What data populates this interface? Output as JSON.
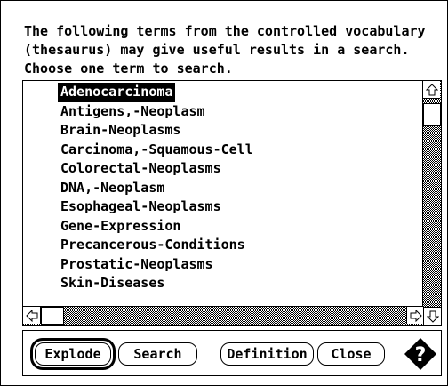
{
  "dialog": {
    "prompt": "The following terms from the controlled vocabulary\n(thesaurus) may give useful results in a search.\nChoose one term to search.",
    "terms": [
      {
        "label": "Adenocarcinoma",
        "selected": true
      },
      {
        "label": "Antigens,-Neoplasm",
        "selected": false
      },
      {
        "label": "Brain-Neoplasms",
        "selected": false
      },
      {
        "label": "Carcinoma,-Squamous-Cell",
        "selected": false
      },
      {
        "label": "Colorectal-Neoplasms",
        "selected": false
      },
      {
        "label": "DNA,-Neoplasm",
        "selected": false
      },
      {
        "label": "Esophageal-Neoplasms",
        "selected": false
      },
      {
        "label": "Gene-Expression",
        "selected": false
      },
      {
        "label": "Precancerous-Conditions",
        "selected": false
      },
      {
        "label": "Prostatic-Neoplasms",
        "selected": false
      },
      {
        "label": "Skin-Diseases",
        "selected": false
      }
    ],
    "buttons": {
      "explode": "Explode",
      "search": "Search",
      "definition": "Definition",
      "close": "Close"
    },
    "icons": {
      "scroll_up": "up-arrow-icon",
      "scroll_down": "down-arrow-icon",
      "scroll_left": "left-arrow-icon",
      "scroll_right": "right-arrow-icon",
      "help": "help-icon"
    }
  }
}
